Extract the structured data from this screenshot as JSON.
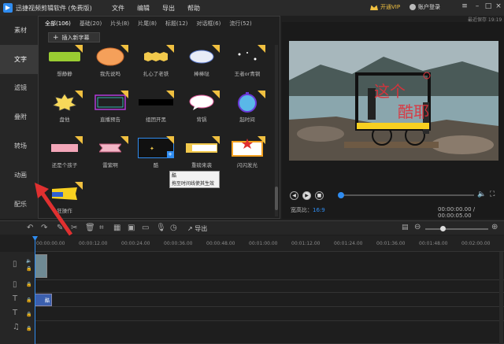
{
  "app": {
    "title": "迅捷视频剪辑软件 (免费版)",
    "menus": [
      "文件",
      "编辑",
      "导出",
      "帮助"
    ],
    "vip_label": "开通VIP",
    "login_label": "账户登录",
    "autosave": "最近保存 19:19"
  },
  "sidebar": {
    "items": [
      {
        "label": "素材"
      },
      {
        "label": "文字"
      },
      {
        "label": "滤镜"
      },
      {
        "label": "叠附"
      },
      {
        "label": "转场"
      },
      {
        "label": "动画"
      },
      {
        "label": "配乐"
      }
    ],
    "active": "文字"
  },
  "panel": {
    "tabs": [
      {
        "label": "全部(106)"
      },
      {
        "label": "基础(20)"
      },
      {
        "label": "片头(8)"
      },
      {
        "label": "片尾(8)"
      },
      {
        "label": "标题(12)"
      },
      {
        "label": "对话框(6)"
      },
      {
        "label": "流行(52)"
      }
    ],
    "insert_label": "插入新字幕",
    "tiles": [
      {
        "label": "想静静",
        "icon": "green-banner"
      },
      {
        "label": "我先说吗",
        "icon": "orange-cloud"
      },
      {
        "label": "扎心了老铁",
        "icon": "yellow-jagged"
      },
      {
        "label": "棒棒哒",
        "icon": "white-cloud"
      },
      {
        "label": "王者or青铜",
        "icon": "sparkle"
      },
      {
        "label": "盘他",
        "icon": "yellow-burst"
      },
      {
        "label": "直播预告",
        "icon": "neon-frame"
      },
      {
        "label": "组团开黑",
        "icon": "black-bar"
      },
      {
        "label": "背锅",
        "icon": "speech-bubble"
      },
      {
        "label": "起时间",
        "icon": "stopwatch"
      },
      {
        "label": "还是个孩子",
        "icon": "pink-banner"
      },
      {
        "label": "雷紫啊",
        "icon": "ribbon"
      },
      {
        "label": "酷",
        "icon": "dark-panel"
      },
      {
        "label": "重磅来袭",
        "icon": "yellow-label"
      },
      {
        "label": "闪闪发光",
        "icon": "star-frame"
      },
      {
        "label": "狂操作",
        "icon": "yellow-flag"
      }
    ],
    "tooltip_title": "酷",
    "tooltip_text": "拖至时间线使其生效"
  },
  "preview": {
    "overlay_line1": "这个",
    "overlay_line2": "酷耶",
    "aspect_label": "宽高比：",
    "aspect_value": "16:9",
    "timecode": "00:00:00.00 / 00:00:05.00",
    "progress": 0.0
  },
  "timeline": {
    "export_label": "导出",
    "ruler": [
      "00:00:00.00",
      "00:00:12.00",
      "00:00:24.00",
      "00:00:36.00",
      "00:00:48.00",
      "00:01:00.00",
      "00:01:12.00",
      "00:01:24.00",
      "00:01:36.00",
      "00:01:48.00",
      "00:02:00.00"
    ],
    "clip_text_label": "酷"
  },
  "colors": {
    "accent": "#2f8cf0",
    "vip": "#f0c040",
    "overlay_text": "#e0303a",
    "arrow": "#e03030"
  }
}
